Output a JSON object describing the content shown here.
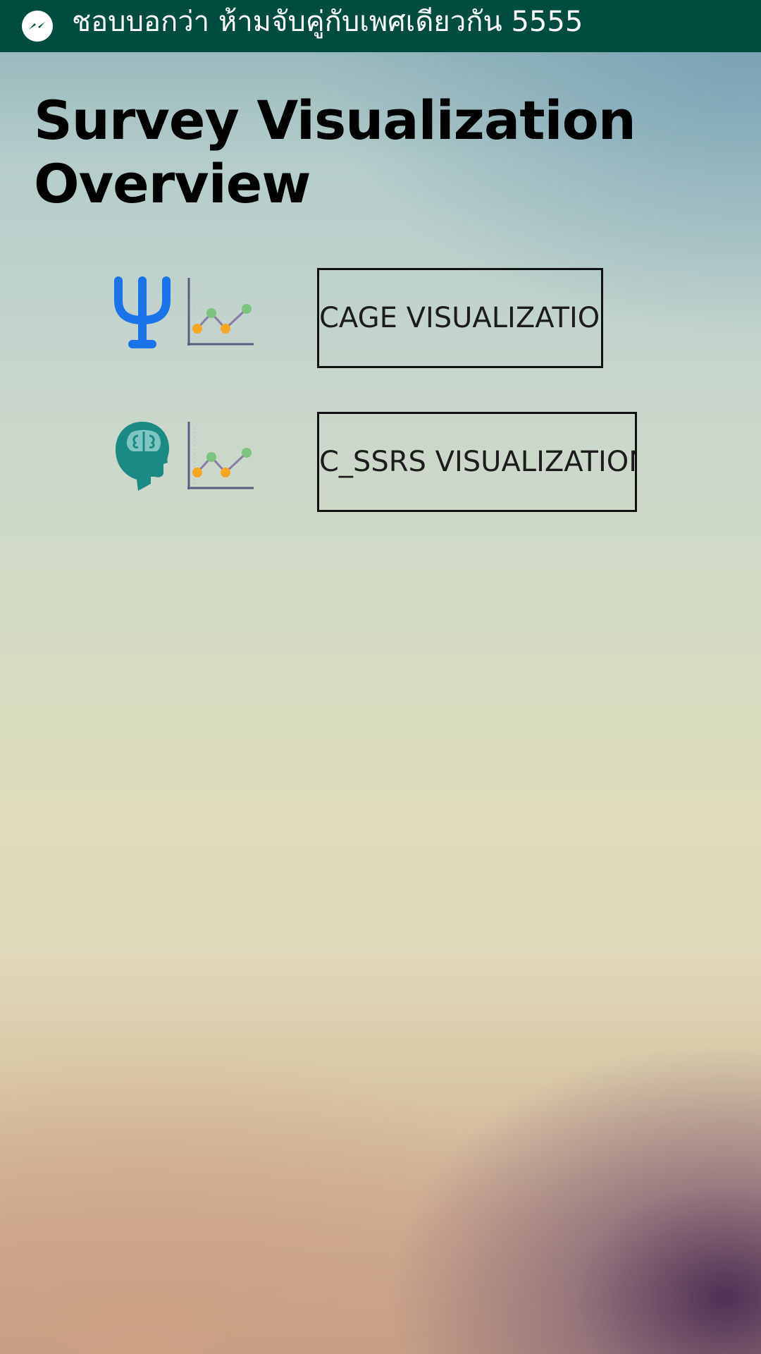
{
  "notification": {
    "app_icon": "messenger-icon",
    "text": "ชอบบอกว่า ห้ามจับคู่กับเพศเดียวกัน 5555",
    "bar_color": "#004d40"
  },
  "page": {
    "title": "Survey Visualization Overview"
  },
  "surveys": [
    {
      "icon": "psi-icon",
      "icon_color": "#1a73e8",
      "chart_icon": "line-chart-icon",
      "button_label": "CAGE VISUALIZATION"
    },
    {
      "icon": "head-brain-icon",
      "icon_color": "#1b8a85",
      "chart_icon": "line-chart-icon",
      "button_label": "C_SSRS VISUALIZATION"
    }
  ]
}
